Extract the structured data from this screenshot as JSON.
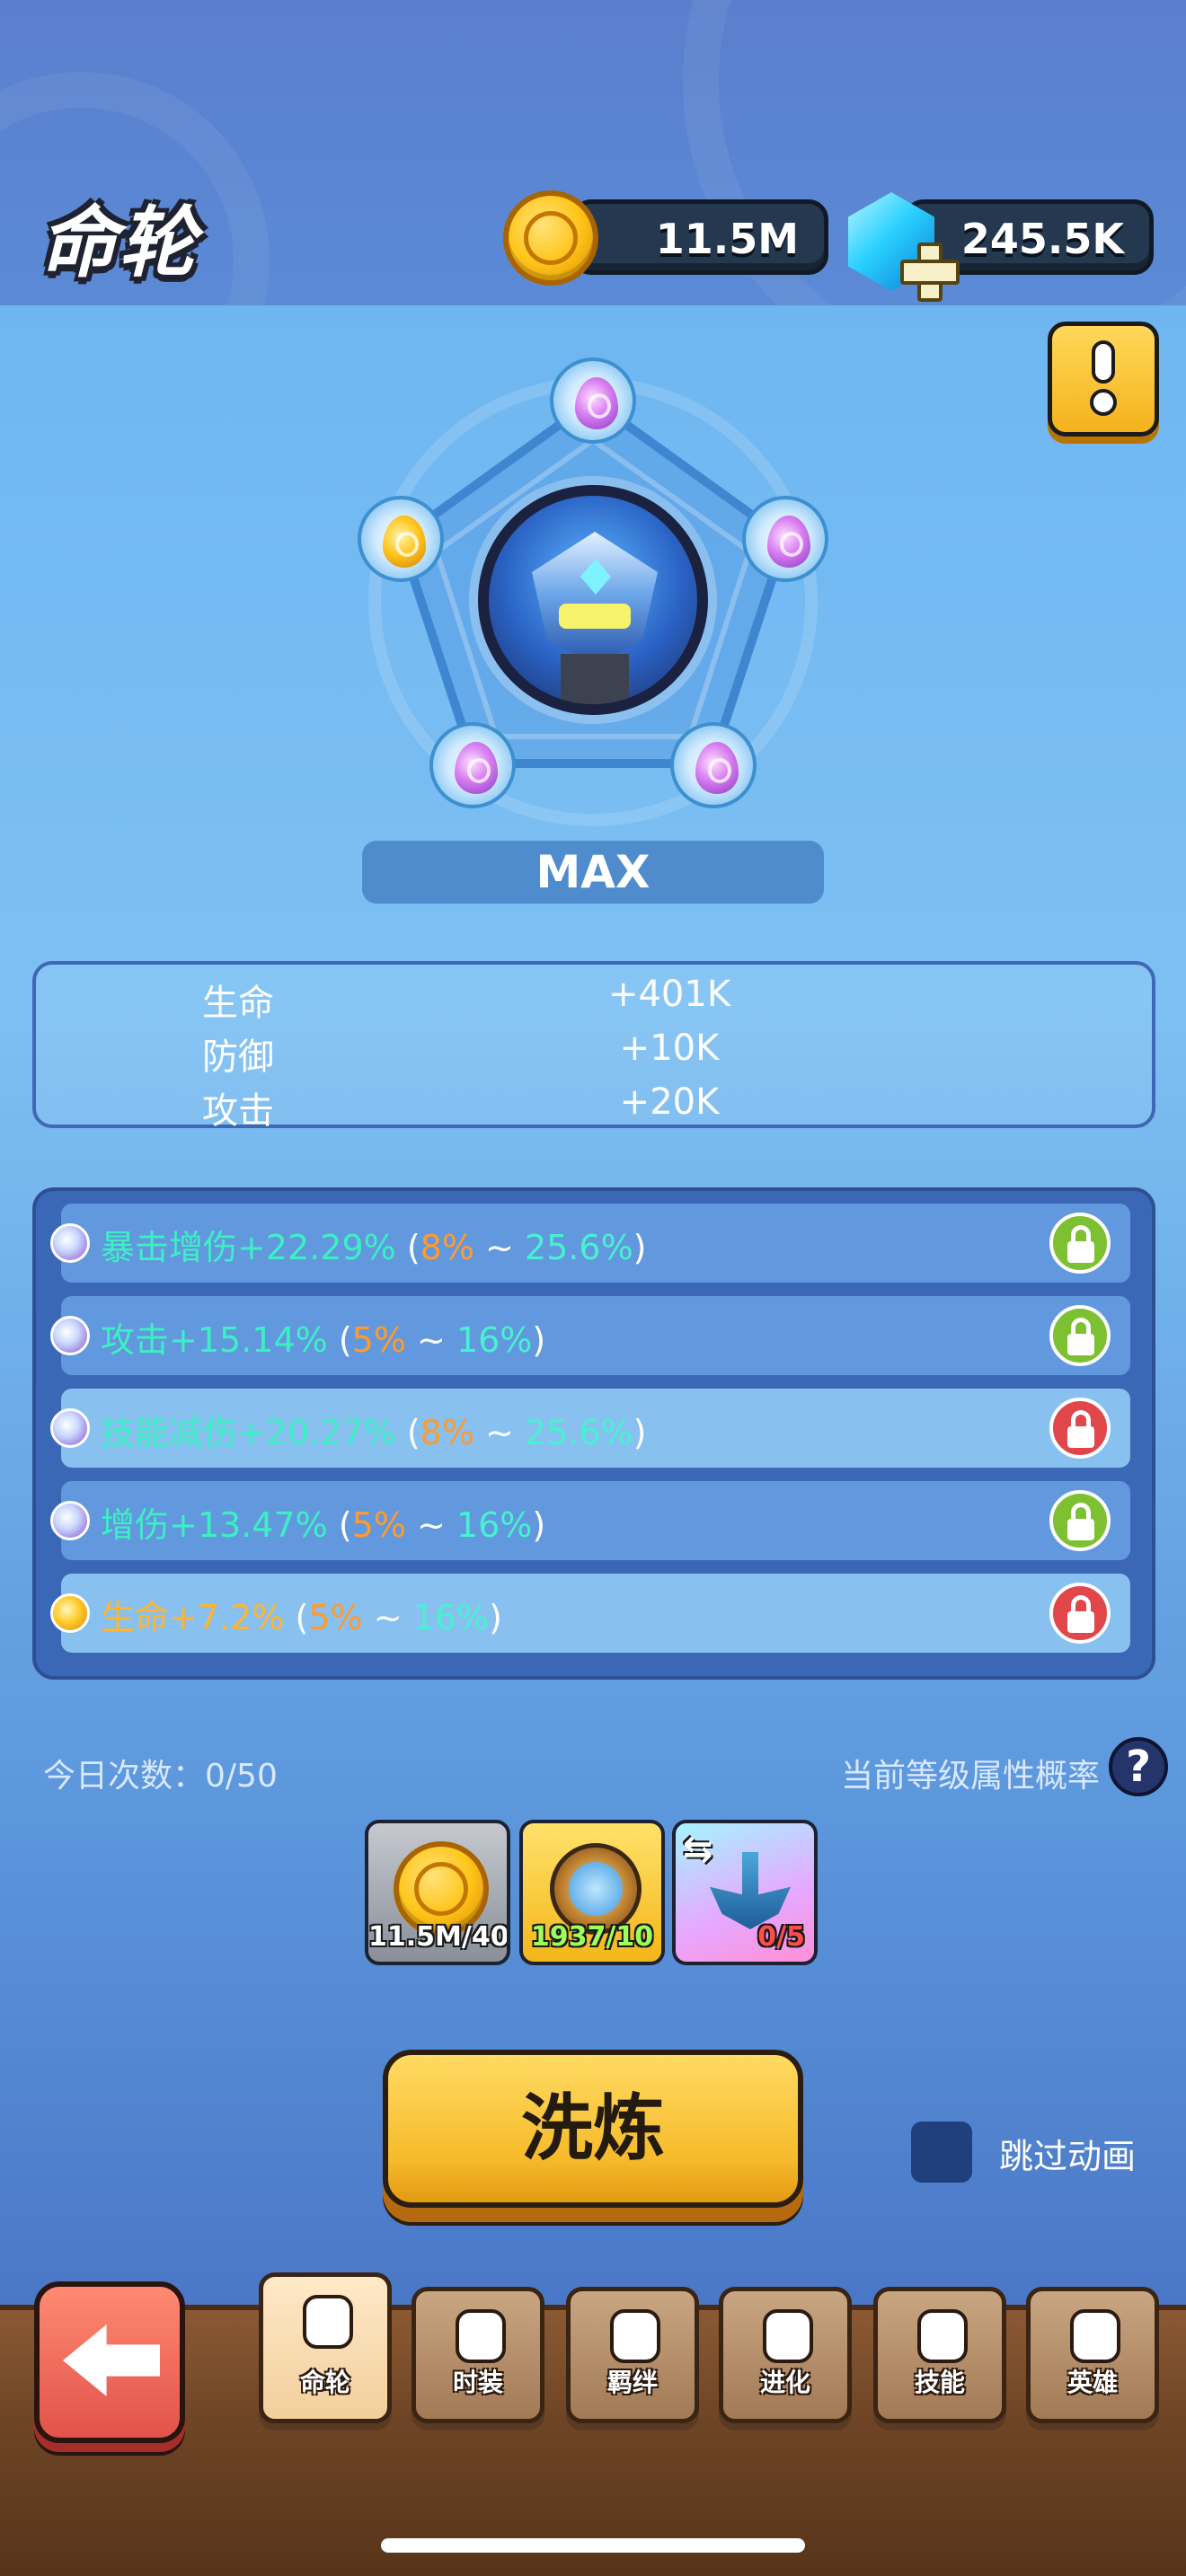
{
  "header": {
    "title": "命轮",
    "gold": "11.5M",
    "gems": "245.5K"
  },
  "wheel": {
    "level_label": "MAX",
    "runes": [
      "purple",
      "purple",
      "purple",
      "purple",
      "gold"
    ]
  },
  "stats": [
    {
      "name": "生命",
      "value": "+401K"
    },
    {
      "name": "防御",
      "value": "+10K"
    },
    {
      "name": "攻击",
      "value": "+20K"
    }
  ],
  "attributes": [
    {
      "orb": "purple",
      "main": "暴击增伤+22.29%",
      "min": "8%",
      "sep": " ~ ",
      "max": "25.6%",
      "locked": "green",
      "row": "dark"
    },
    {
      "orb": "purple",
      "main": "攻击+15.14%",
      "min": "5%",
      "sep": " ~ ",
      "max": "16%",
      "locked": "green",
      "row": "dark"
    },
    {
      "orb": "purple",
      "main": "技能减伤+20.27%",
      "min": "8%",
      "sep": " ~ ",
      "max": "25.6%",
      "locked": "red",
      "row": "light"
    },
    {
      "orb": "purple",
      "main": "增伤+13.47%",
      "min": "5%",
      "sep": " ~ ",
      "max": "16%",
      "locked": "green",
      "row": "dark"
    },
    {
      "orb": "gold",
      "main": "生命+7.2%",
      "min": "5%",
      "sep": " ~ ",
      "max": "16%",
      "locked": "red",
      "row": "light"
    }
  ],
  "daily": {
    "label": "今日次数：0/50",
    "prob_label": "当前等级属性概率",
    "help": "?"
  },
  "costs": [
    {
      "icon": "gold-coin-icon",
      "count": "11.5M/40K",
      "count_color": "#ffffff"
    },
    {
      "icon": "compass-icon",
      "count": "1937/10",
      "count_color": "#9dff5a"
    },
    {
      "icon": "anchor-icon",
      "count": "0/5",
      "count_color": "#ff4d4d"
    }
  ],
  "actions": {
    "refine": "洗炼",
    "skip_animation": "跳过动画"
  },
  "nav": {
    "tabs": [
      {
        "label": "命轮",
        "active": true
      },
      {
        "label": "时装",
        "active": false
      },
      {
        "label": "羁绊",
        "active": false
      },
      {
        "label": "进化",
        "active": false
      },
      {
        "label": "技能",
        "active": false
      },
      {
        "label": "英雄",
        "active": false
      }
    ]
  },
  "colors": {
    "accent_gold": "#f6bb2b",
    "lock_green": "#7dc133",
    "lock_red": "#e1464a"
  }
}
